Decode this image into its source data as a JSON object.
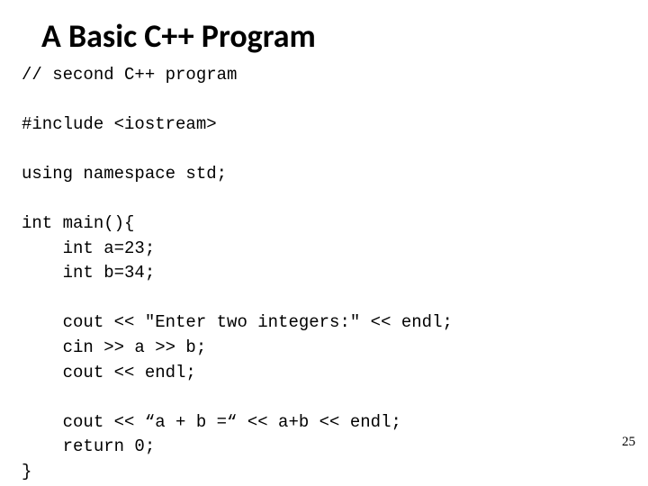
{
  "title": "A Basic C++ Program",
  "code": {
    "l1": "// second C++ program",
    "l2": "",
    "l3": "#include <iostream>",
    "l4": "",
    "l5": "using namespace std;",
    "l6": "",
    "l7": "int main(){",
    "l8": "    int a=23;",
    "l9": "    int b=34;",
    "l10": "",
    "l11": "    cout << \"Enter two integers:\" << endl;",
    "l12": "    cin >> a >> b;",
    "l13": "    cout << endl;",
    "l14": "",
    "l15": "    cout << “a + b =“ << a+b << endl;",
    "l16": "    return 0;",
    "l17": "}"
  },
  "page_number": "25"
}
